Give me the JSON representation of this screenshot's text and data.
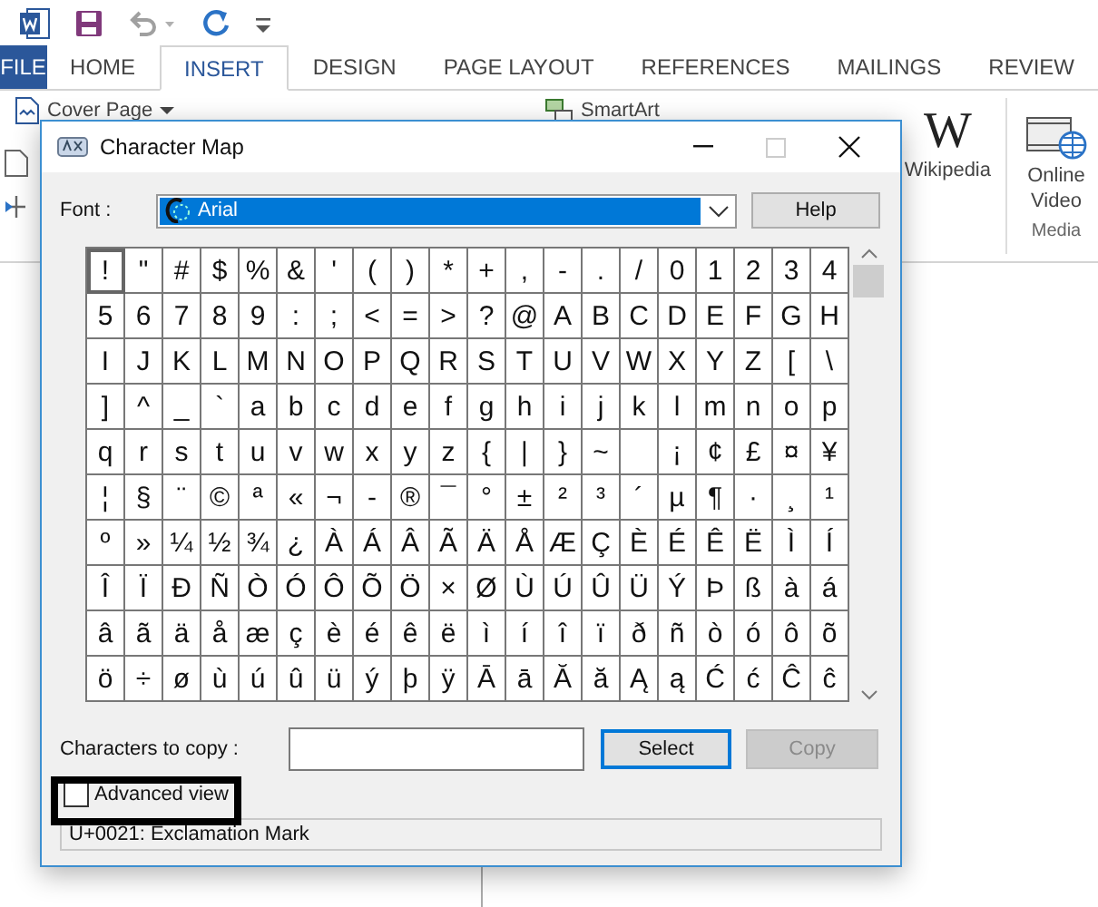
{
  "ribbon_tabs": [
    {
      "label": "FILE",
      "kind": "file",
      "selected": false
    },
    {
      "label": "HOME",
      "kind": "tab",
      "selected": false
    },
    {
      "label": "INSERT",
      "kind": "tab",
      "selected": true
    },
    {
      "label": "DESIGN",
      "kind": "tab",
      "selected": false
    },
    {
      "label": "PAGE LAYOUT",
      "kind": "tab",
      "selected": false
    },
    {
      "label": "REFERENCES",
      "kind": "tab",
      "selected": false
    },
    {
      "label": "MAILINGS",
      "kind": "tab",
      "selected": false
    },
    {
      "label": "REVIEW",
      "kind": "tab",
      "selected": false
    }
  ],
  "ribbon": {
    "cover_page": "Cover Page",
    "smartart": "SmartArt",
    "wikipedia_logo": "W",
    "wikipedia": "Wikipedia",
    "online_video": "Online Video",
    "group_label": "Media"
  },
  "dialog": {
    "title": "Character Map",
    "font_label": "Font :",
    "font": {
      "value": "Arial"
    },
    "help_button": "Help",
    "rows": [
      [
        {
          "char": "!",
          "selected": true
        },
        {
          "char": "\"",
          "selected": false
        },
        {
          "char": "#",
          "selected": false
        },
        {
          "char": "$",
          "selected": false
        },
        {
          "char": "%",
          "selected": false
        },
        {
          "char": "&",
          "selected": false
        },
        {
          "char": "'",
          "selected": false
        },
        {
          "char": "(",
          "selected": false
        },
        {
          "char": ")",
          "selected": false
        },
        {
          "char": "*",
          "selected": false
        },
        {
          "char": "+",
          "selected": false
        },
        {
          "char": ",",
          "selected": false
        },
        {
          "char": "-",
          "selected": false
        },
        {
          "char": ".",
          "selected": false
        },
        {
          "char": "/",
          "selected": false
        },
        {
          "char": "0",
          "selected": false
        },
        {
          "char": "1",
          "selected": false
        },
        {
          "char": "2",
          "selected": false
        },
        {
          "char": "3",
          "selected": false
        },
        {
          "char": "4",
          "selected": false
        }
      ],
      [
        {
          "char": "5",
          "selected": false
        },
        {
          "char": "6",
          "selected": false
        },
        {
          "char": "7",
          "selected": false
        },
        {
          "char": "8",
          "selected": false
        },
        {
          "char": "9",
          "selected": false
        },
        {
          "char": ":",
          "selected": false
        },
        {
          "char": ";",
          "selected": false
        },
        {
          "char": "<",
          "selected": false
        },
        {
          "char": "=",
          "selected": false
        },
        {
          "char": ">",
          "selected": false
        },
        {
          "char": "?",
          "selected": false
        },
        {
          "char": "@",
          "selected": false
        },
        {
          "char": "A",
          "selected": false
        },
        {
          "char": "B",
          "selected": false
        },
        {
          "char": "C",
          "selected": false
        },
        {
          "char": "D",
          "selected": false
        },
        {
          "char": "E",
          "selected": false
        },
        {
          "char": "F",
          "selected": false
        },
        {
          "char": "G",
          "selected": false
        },
        {
          "char": "H",
          "selected": false
        }
      ],
      [
        {
          "char": "I",
          "selected": false
        },
        {
          "char": "J",
          "selected": false
        },
        {
          "char": "K",
          "selected": false
        },
        {
          "char": "L",
          "selected": false
        },
        {
          "char": "M",
          "selected": false
        },
        {
          "char": "N",
          "selected": false
        },
        {
          "char": "O",
          "selected": false
        },
        {
          "char": "P",
          "selected": false
        },
        {
          "char": "Q",
          "selected": false
        },
        {
          "char": "R",
          "selected": false
        },
        {
          "char": "S",
          "selected": false
        },
        {
          "char": "T",
          "selected": false
        },
        {
          "char": "U",
          "selected": false
        },
        {
          "char": "V",
          "selected": false
        },
        {
          "char": "W",
          "selected": false
        },
        {
          "char": "X",
          "selected": false
        },
        {
          "char": "Y",
          "selected": false
        },
        {
          "char": "Z",
          "selected": false
        },
        {
          "char": "[",
          "selected": false
        },
        {
          "char": "\\",
          "selected": false
        }
      ],
      [
        {
          "char": "]",
          "selected": false
        },
        {
          "char": "^",
          "selected": false
        },
        {
          "char": "_",
          "selected": false
        },
        {
          "char": "`",
          "selected": false
        },
        {
          "char": "a",
          "selected": false
        },
        {
          "char": "b",
          "selected": false
        },
        {
          "char": "c",
          "selected": false
        },
        {
          "char": "d",
          "selected": false
        },
        {
          "char": "e",
          "selected": false
        },
        {
          "char": "f",
          "selected": false
        },
        {
          "char": "g",
          "selected": false
        },
        {
          "char": "h",
          "selected": false
        },
        {
          "char": "i",
          "selected": false
        },
        {
          "char": "j",
          "selected": false
        },
        {
          "char": "k",
          "selected": false
        },
        {
          "char": "l",
          "selected": false
        },
        {
          "char": "m",
          "selected": false
        },
        {
          "char": "n",
          "selected": false
        },
        {
          "char": "o",
          "selected": false
        },
        {
          "char": "p",
          "selected": false
        }
      ],
      [
        {
          "char": "q",
          "selected": false
        },
        {
          "char": "r",
          "selected": false
        },
        {
          "char": "s",
          "selected": false
        },
        {
          "char": "t",
          "selected": false
        },
        {
          "char": "u",
          "selected": false
        },
        {
          "char": "v",
          "selected": false
        },
        {
          "char": "w",
          "selected": false
        },
        {
          "char": "x",
          "selected": false
        },
        {
          "char": "y",
          "selected": false
        },
        {
          "char": "z",
          "selected": false
        },
        {
          "char": "{",
          "selected": false
        },
        {
          "char": "|",
          "selected": false
        },
        {
          "char": "}",
          "selected": false
        },
        {
          "char": "~",
          "selected": false
        },
        {
          "selected": false
        },
        {
          "char": "¡",
          "selected": false
        },
        {
          "char": "¢",
          "selected": false
        },
        {
          "char": "£",
          "selected": false
        },
        {
          "char": "¤",
          "selected": false
        },
        {
          "char": "¥",
          "selected": false
        }
      ],
      [
        {
          "char": "¦",
          "selected": false
        },
        {
          "char": "§",
          "selected": false
        },
        {
          "char": "¨",
          "selected": false
        },
        {
          "char": "©",
          "selected": false
        },
        {
          "char": "ª",
          "selected": false
        },
        {
          "char": "«",
          "selected": false
        },
        {
          "char": "¬",
          "selected": false
        },
        {
          "char": "-",
          "selected": false
        },
        {
          "char": "®",
          "selected": false
        },
        {
          "char": "¯",
          "selected": false
        },
        {
          "char": "°",
          "selected": false
        },
        {
          "char": "±",
          "selected": false
        },
        {
          "char": "²",
          "selected": false
        },
        {
          "char": "³",
          "selected": false
        },
        {
          "char": "´",
          "selected": false
        },
        {
          "char": "µ",
          "selected": false
        },
        {
          "char": "¶",
          "selected": false
        },
        {
          "char": "·",
          "selected": false
        },
        {
          "char": "¸",
          "selected": false
        },
        {
          "char": "¹",
          "selected": false
        }
      ],
      [
        {
          "char": "º",
          "selected": false
        },
        {
          "char": "»",
          "selected": false
        },
        {
          "char": "¼",
          "selected": false
        },
        {
          "char": "½",
          "selected": false
        },
        {
          "char": "¾",
          "selected": false
        },
        {
          "char": "¿",
          "selected": false
        },
        {
          "char": "À",
          "selected": false
        },
        {
          "char": "Á",
          "selected": false
        },
        {
          "char": "Â",
          "selected": false
        },
        {
          "char": "Ã",
          "selected": false
        },
        {
          "char": "Ä",
          "selected": false
        },
        {
          "char": "Å",
          "selected": false
        },
        {
          "char": "Æ",
          "selected": false
        },
        {
          "char": "Ç",
          "selected": false
        },
        {
          "char": "È",
          "selected": false
        },
        {
          "char": "É",
          "selected": false
        },
        {
          "char": "Ê",
          "selected": false
        },
        {
          "char": "Ë",
          "selected": false
        },
        {
          "char": "Ì",
          "selected": false
        },
        {
          "char": "Í",
          "selected": false
        }
      ],
      [
        {
          "char": "Î",
          "selected": false
        },
        {
          "char": "Ï",
          "selected": false
        },
        {
          "char": "Ð",
          "selected": false
        },
        {
          "char": "Ñ",
          "selected": false
        },
        {
          "char": "Ò",
          "selected": false
        },
        {
          "char": "Ó",
          "selected": false
        },
        {
          "char": "Ô",
          "selected": false
        },
        {
          "char": "Õ",
          "selected": false
        },
        {
          "char": "Ö",
          "selected": false
        },
        {
          "char": "×",
          "selected": false
        },
        {
          "char": "Ø",
          "selected": false
        },
        {
          "char": "Ù",
          "selected": false
        },
        {
          "char": "Ú",
          "selected": false
        },
        {
          "char": "Û",
          "selected": false
        },
        {
          "char": "Ü",
          "selected": false
        },
        {
          "char": "Ý",
          "selected": false
        },
        {
          "char": "Þ",
          "selected": false
        },
        {
          "char": "ß",
          "selected": false
        },
        {
          "char": "à",
          "selected": false
        },
        {
          "char": "á",
          "selected": false
        }
      ],
      [
        {
          "char": "â",
          "selected": false
        },
        {
          "char": "ã",
          "selected": false
        },
        {
          "char": "ä",
          "selected": false
        },
        {
          "char": "å",
          "selected": false
        },
        {
          "char": "æ",
          "selected": false
        },
        {
          "char": "ç",
          "selected": false
        },
        {
          "char": "è",
          "selected": false
        },
        {
          "char": "é",
          "selected": false
        },
        {
          "char": "ê",
          "selected": false
        },
        {
          "char": "ë",
          "selected": false
        },
        {
          "char": "ì",
          "selected": false
        },
        {
          "char": "í",
          "selected": false
        },
        {
          "char": "î",
          "selected": false
        },
        {
          "char": "ï",
          "selected": false
        },
        {
          "char": "ð",
          "selected": false
        },
        {
          "char": "ñ",
          "selected": false
        },
        {
          "char": "ò",
          "selected": false
        },
        {
          "char": "ó",
          "selected": false
        },
        {
          "char": "ô",
          "selected": false
        },
        {
          "char": "õ",
          "selected": false
        }
      ],
      [
        {
          "char": "ö",
          "selected": false
        },
        {
          "char": "÷",
          "selected": false
        },
        {
          "char": "ø",
          "selected": false
        },
        {
          "char": "ù",
          "selected": false
        },
        {
          "char": "ú",
          "selected": false
        },
        {
          "char": "û",
          "selected": false
        },
        {
          "char": "ü",
          "selected": false
        },
        {
          "char": "ý",
          "selected": false
        },
        {
          "char": "þ",
          "selected": false
        },
        {
          "char": "ÿ",
          "selected": false
        },
        {
          "char": "Ā",
          "selected": false
        },
        {
          "char": "ā",
          "selected": false
        },
        {
          "char": "Ă",
          "selected": false
        },
        {
          "char": "ă",
          "selected": false
        },
        {
          "char": "Ą",
          "selected": false
        },
        {
          "char": "ą",
          "selected": false
        },
        {
          "char": "Ć",
          "selected": false
        },
        {
          "char": "ć",
          "selected": false
        },
        {
          "char": "Ĉ",
          "selected": false
        },
        {
          "char": "ĉ",
          "selected": false
        }
      ]
    ],
    "copy_label": "Characters to copy :",
    "select_button": "Select",
    "copy_button": {
      "label": "Copy",
      "disabled": true
    },
    "advanced_view": {
      "label": "Advanced view",
      "checked": false,
      "highlighted": true
    },
    "status": "U+0021: Exclamation Mark"
  }
}
